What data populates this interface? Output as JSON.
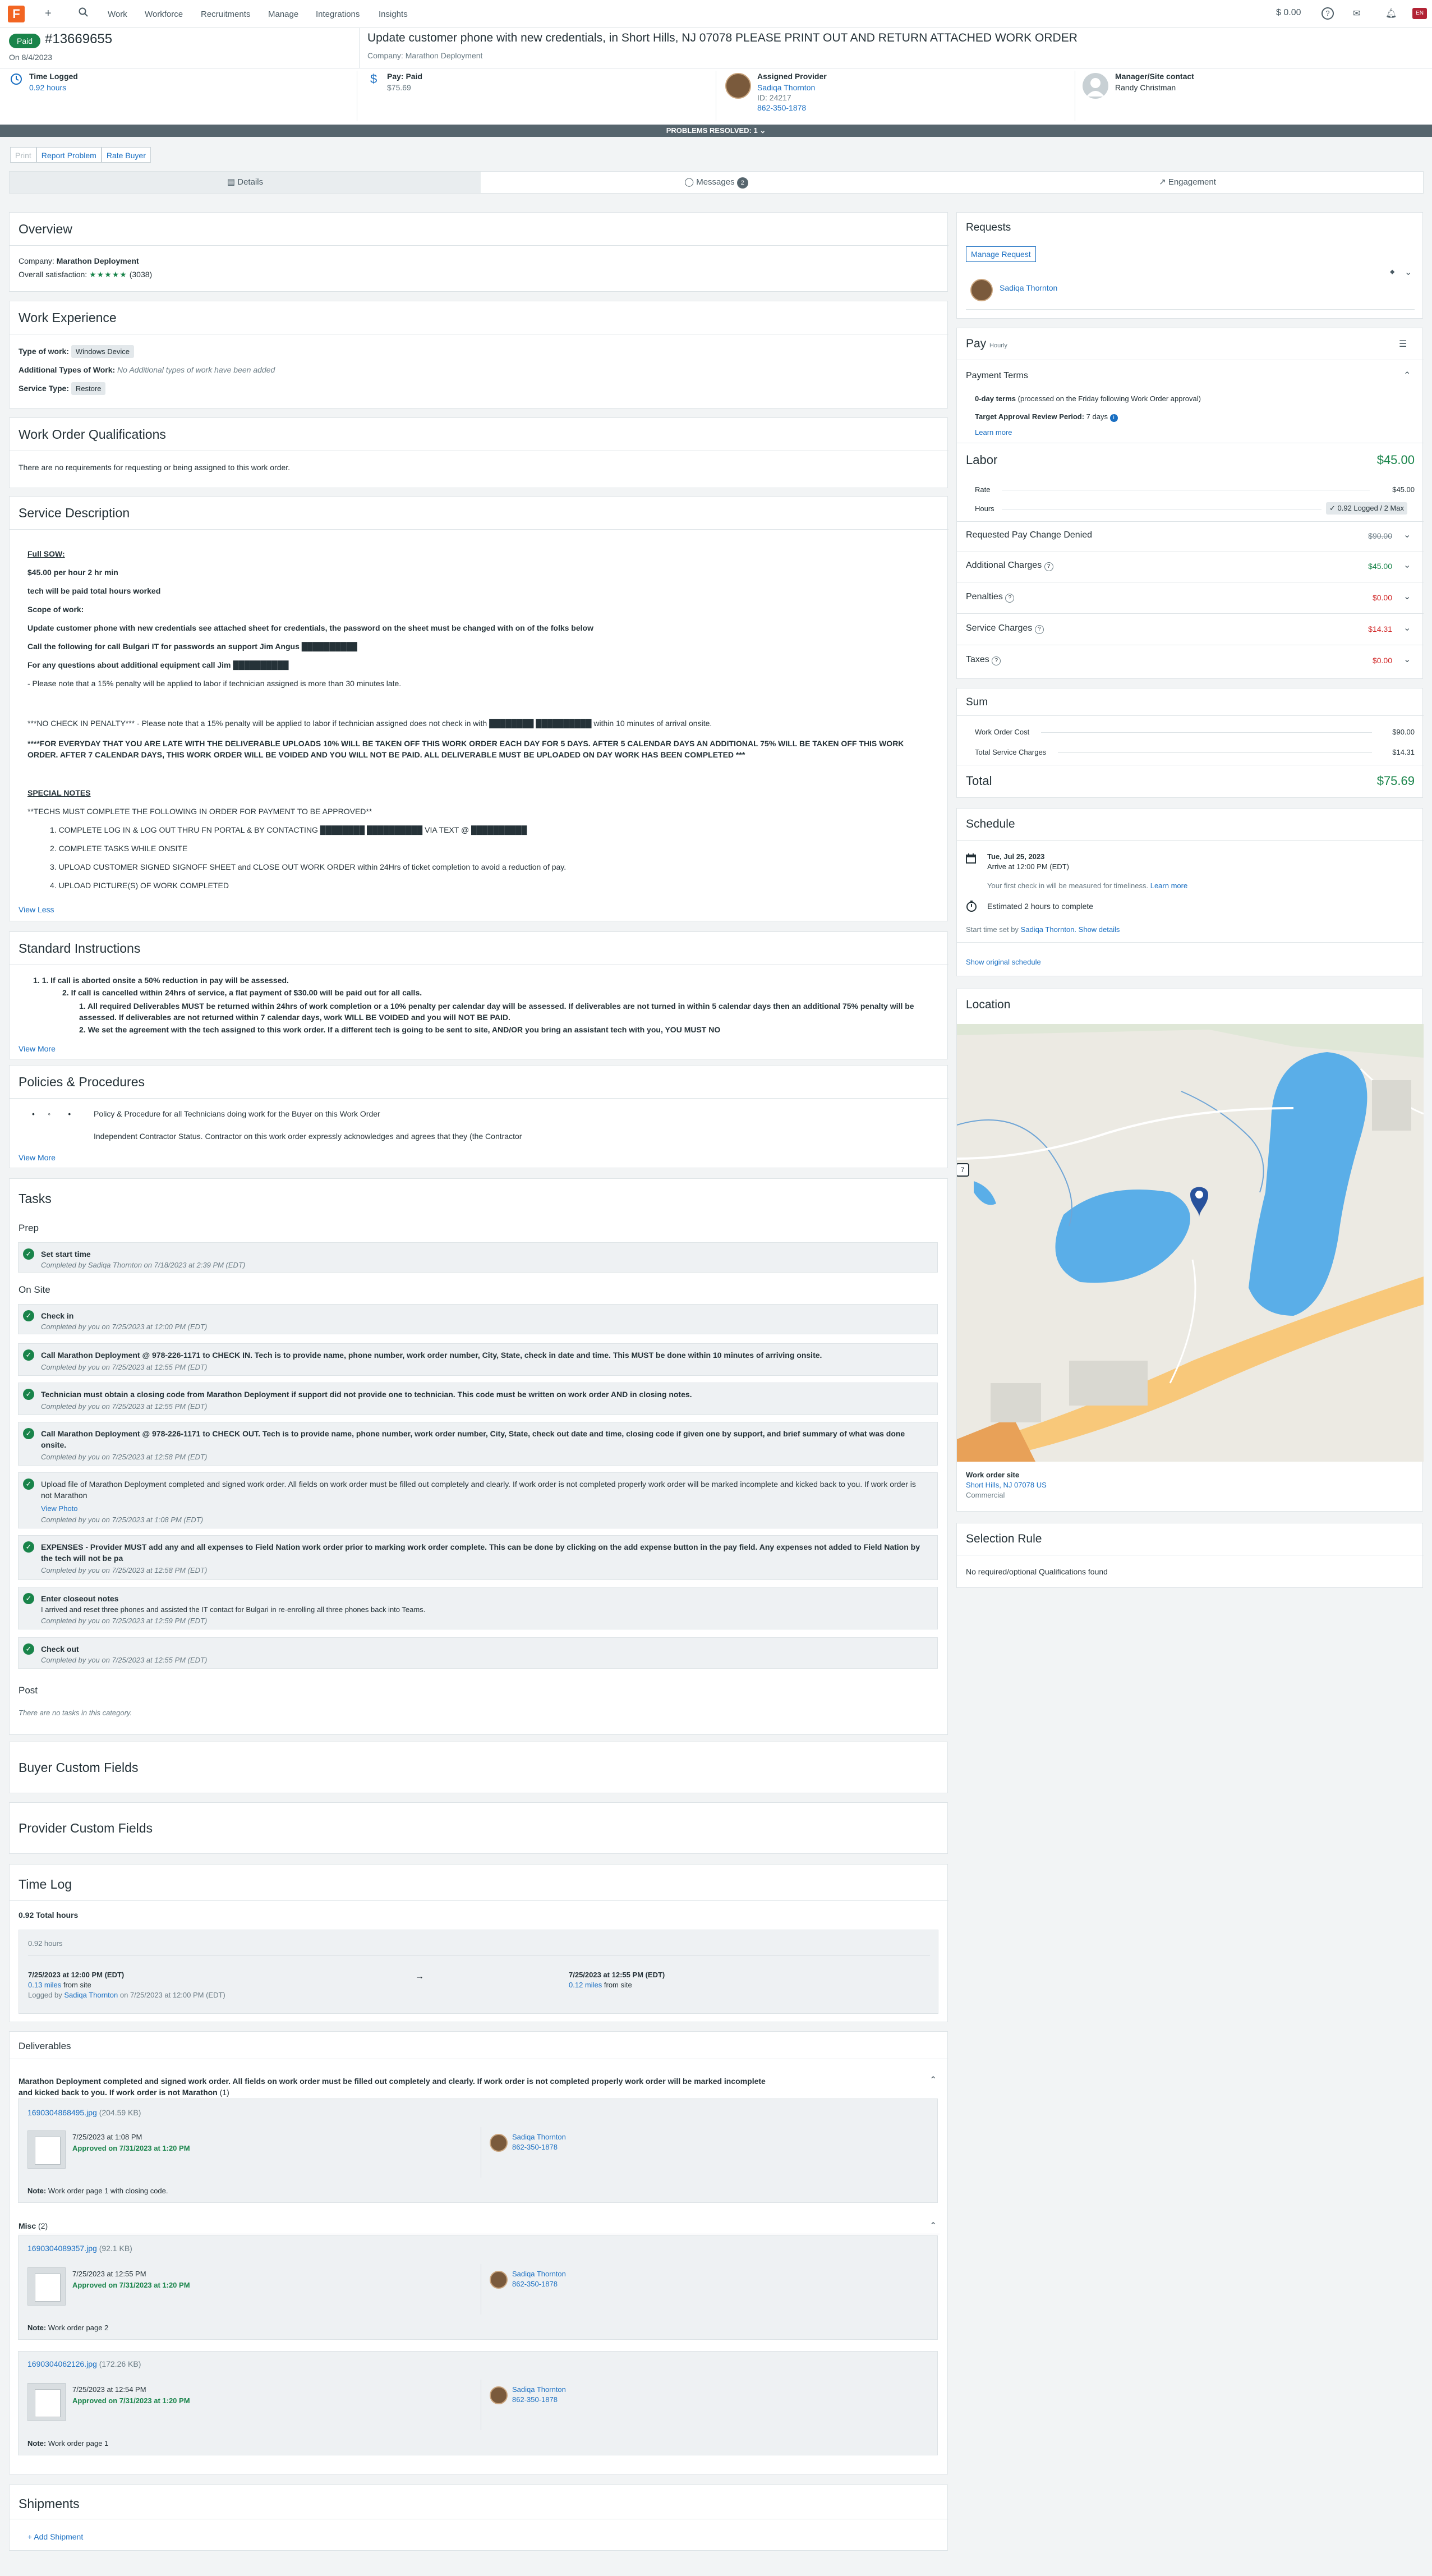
{
  "nav": {
    "logo": "F",
    "items": [
      "Work",
      "Workforce",
      "Recruitments",
      "Manage",
      "Integrations",
      "Insights"
    ],
    "balance": "0.00",
    "help": "?",
    "flag": "EN"
  },
  "header": {
    "status_badge": "Paid",
    "wo_number": "#13669655",
    "on_date": "On 8/4/2023",
    "title": "Update customer phone with new credentials, in Short Hills, NJ 07078 PLEASE PRINT OUT AND RETURN ATTACHED WORK ORDER",
    "company": "Company: Marathon Deployment"
  },
  "summary": {
    "time_logged_label": "Time Logged",
    "time_logged_value": "0.92 hours",
    "pay_label": "Pay: Paid",
    "pay_value": "$75.69",
    "provider_label": "Assigned Provider",
    "provider_name": "Sadiqa Thornton",
    "provider_id": "ID: 24217",
    "provider_phone": "862-350-1878",
    "manager_label": "Manager/Site contact",
    "manager_name": "Randy Christman"
  },
  "problems_banner": "PROBLEMS RESOLVED: 1 ⌄",
  "actions": {
    "print": "Print",
    "report": "Report Problem",
    "rate": "Rate Buyer"
  },
  "tabs": {
    "details": "Details",
    "messages": "Messages",
    "messages_count": "2",
    "engagement": "Engagement"
  },
  "overview": {
    "title": "Overview",
    "company_label": "Company:",
    "company": "Marathon Deployment",
    "satisfaction_label": "Overall satisfaction:",
    "stars": "★★★★★",
    "reviews": "(3038)"
  },
  "work_experience": {
    "title": "Work Experience",
    "type_label": "Type of work:",
    "type_value": "Windows Device",
    "additional_label": "Additional Types of Work:",
    "additional_value": "No Additional types of work have been added",
    "service_label": "Service Type:",
    "service_value": "Restore"
  },
  "qualifications": {
    "title": "Work Order Qualifications",
    "text": "There are no requirements for requesting or being assigned to this work order."
  },
  "service_description": {
    "title": "Service Description",
    "lines": [
      "Full SOW:",
      "$45.00 per hour 2 hr min",
      "tech will be paid total hours worked",
      "Scope of work:",
      "Update customer phone with new credentials see attached sheet for credentials, the password on the sheet must be changed with on of the folks below",
      "Call the following for call Bulgari IT for passwords an support Jim Angus ██████████",
      "For any questions about additional equipment call Jim ██████████",
      "- Please note that a 15% penalty will be applied to labor if technician assigned is more than 30 minutes late.",
      "***NO CHECK IN PENALTY*** - Please note that a 15% penalty will be applied to labor if technician assigned does not check in with ████████ ██████████ within 10 minutes of arrival onsite.",
      "****FOR EVERYDAY THAT YOU ARE LATE WITH THE DELIVERABLE UPLOADS 10% WILL BE TAKEN OFF THIS WORK ORDER EACH DAY FOR 5 DAYS. AFTER 5 CALENDAR DAYS AN ADDITIONAL 75% WILL BE TAKEN OFF THIS WORK ORDER. AFTER 7 CALENDAR DAYS, THIS WORK ORDER WILL BE VOIDED AND YOU WILL NOT BE PAID. ALL DELIVERABLE MUST BE UPLOADED ON DAY WORK HAS BEEN COMPLETED ***",
      "SPECIAL NOTES",
      "**TECHS MUST COMPLETE THE FOLLOWING IN ORDER FOR PAYMENT TO BE APPROVED**",
      "1. COMPLETE LOG IN & LOG OUT THRU FN PORTAL & BY CONTACTING ████████ ██████████ VIA TEXT @ ██████████",
      "2. COMPLETE TASKS WHILE ONSITE",
      "3. UPLOAD CUSTOMER SIGNED SIGNOFF SHEET and CLOSE OUT WORK ORDER within 24Hrs of ticket completion to avoid a reduction of pay.",
      "4. UPLOAD PICTURE(S) OF WORK COMPLETED"
    ],
    "view_less": "View Less"
  },
  "standard_instructions": {
    "title": "Standard Instructions",
    "items": [
      "1.  1.   If call is aborted onsite a 50% reduction in pay will be assessed.",
      "2.   If call is cancelled within 24hrs of service, a flat payment of $30.00 will be paid out for all calls.",
      "1. All required Deliverables MUST be returned within 24hrs of work completion or a 10% penalty per calendar day will be assessed.  If deliverables are not turned in within 5 calendar days then an additional 75% penalty will be assessed.  If deliverables are not returned within 7 calendar days, work WILL BE VOIDED and you will NOT BE PAID.",
      "2. We set the agreement with the tech assigned to this work order.  If a different tech is going to be sent to site, AND/OR you bring an assistant tech with you, YOU MUST NO"
    ],
    "view_more": "View More"
  },
  "policies": {
    "title": "Policies & Procedures",
    "item": "Policy & Procedure for all Technicians doing work for the Buyer on this Work Order",
    "text": "Independent Contractor Status.  Contractor on this work order expressly acknowledges and agrees that they (the Contractor",
    "view_more": "View More"
  },
  "tasks": {
    "title": "Tasks",
    "prep_label": "Prep",
    "onsite_label": "On Site",
    "post_label": "Post",
    "post_empty": "There are no tasks in this category.",
    "prep": [
      {
        "title": "Set start time",
        "completed": "Completed by Sadiqa Thornton on 7/18/2023 at 2:39 PM (EDT)"
      }
    ],
    "onsite": [
      {
        "title": "Check in",
        "completed": "Completed by you on 7/25/2023 at 12:00 PM (EDT)"
      },
      {
        "title": "Call Marathon Deployment @ 978-226-1171 to CHECK IN. Tech is to provide name, phone number, work order number, City, State, check in date and time. This MUST be done within 10 minutes of arriving onsite.",
        "completed": "Completed by you on 7/25/2023 at 12:55 PM (EDT)"
      },
      {
        "title": "Technician must obtain a closing code from Marathon Deployment if support did not provide one to technician. This code must be written on work order AND in closing notes.",
        "completed": "Completed by you on 7/25/2023 at 12:55 PM (EDT)"
      },
      {
        "title": "Call Marathon Deployment @ 978-226-1171 to CHECK OUT. Tech is to provide name, phone number, work order number, City, State, check out date and time, closing code if given one by support, and brief summary of what was done onsite.",
        "completed": "Completed by you on 7/25/2023 at 12:58 PM (EDT)"
      },
      {
        "title": "Upload file of Marathon Deployment completed and signed work order. All fields on work order must be filled out completely and clearly. If work order is not completed properly work order will be marked incomplete and kicked back to you. If work order is not Marathon",
        "extra": "View Photo",
        "completed": "Completed by you on 7/25/2023 at 1:08 PM (EDT)"
      },
      {
        "title": "EXPENSES - Provider MUST add any and all expenses to Field Nation work order prior to marking work order complete. This can be done by clicking on the add expense button in the pay field. Any expenses not added to Field Nation by the tech will not be pa",
        "completed": "Completed by you on 7/25/2023 at 12:58 PM (EDT)"
      },
      {
        "title": "Enter closeout notes",
        "note": "I arrived and reset three phones and assisted the IT contact for Bulgari in re-enrolling all three phones back into Teams.",
        "completed": "Completed by you on 7/25/2023 at 12:59 PM (EDT)"
      },
      {
        "title": "Check out",
        "completed": "Completed by you on 7/25/2023 at 12:55 PM (EDT)"
      }
    ]
  },
  "buyer_custom_fields": {
    "title": "Buyer Custom Fields"
  },
  "provider_custom_fields": {
    "title": "Provider Custom Fields"
  },
  "time_log": {
    "title": "Time Log",
    "total": "0.92 Total hours",
    "entry_hours": "0.92 hours",
    "start": "7/25/2023 at 12:00 PM (EDT)",
    "start_distance": "0.13 miles",
    "start_distance_suffix": "from site",
    "logged_by": "Logged by",
    "logged_name": "Sadiqa Thornton",
    "logged_when": "on 7/25/2023 at 12:00 PM (EDT)",
    "arrow": "→",
    "end": "7/25/2023 at 12:55 PM (EDT)",
    "end_distance": "0.12 miles",
    "end_distance_suffix": "from site"
  },
  "deliverables": {
    "title": "Deliverables",
    "group1_title": "Marathon Deployment completed and signed work order. All fields on work order must be filled out completely and clearly. If work order is not completed properly work order will be marked incomplete and kicked back to you. If work order is not Marathon",
    "group1_count": "(1)",
    "group2_title": "Misc",
    "group2_count": "(2)",
    "note_label": "Note:",
    "files": [
      {
        "name": "1690304868495.jpg",
        "size": "(204.59 KB)",
        "date": "7/25/2023 at 1:08 PM",
        "approved": "Approved on 7/31/2023 at 1:20 PM",
        "person": "Sadiqa Thornton",
        "phone": "862-350-1878",
        "note": "Work order page 1 with closing code."
      },
      {
        "name": "1690304089357.jpg",
        "size": "(92.1 KB)",
        "date": "7/25/2023 at 12:55 PM",
        "approved": "Approved on 7/31/2023 at 1:20 PM",
        "person": "Sadiqa Thornton",
        "phone": "862-350-1878",
        "note": "Work order page 2"
      },
      {
        "name": "1690304062126.jpg",
        "size": "(172.26 KB)",
        "date": "7/25/2023 at 12:54 PM",
        "approved": "Approved on 7/31/2023 at 1:20 PM",
        "person": "Sadiqa Thornton",
        "phone": "862-350-1878",
        "note": "Work order page 1"
      }
    ]
  },
  "shipments": {
    "title": "Shipments",
    "add": "+ Add Shipment"
  },
  "requests": {
    "title": "Requests",
    "manage": "Manage Request",
    "person": "Sadiqa Thornton"
  },
  "pay": {
    "title": "Pay",
    "type": "Hourly",
    "payment_terms_label": "Payment Terms",
    "terms_strong": "0-day terms",
    "terms_rest": "(processed on the Friday following Work Order approval)",
    "review_label": "Target Approval Review Period:",
    "review_value": "7 days",
    "learn_more": "Learn more",
    "labor_label": "Labor",
    "labor_value": "$45.00",
    "rate_label": "Rate",
    "rate_value": "$45.00",
    "hours_label": "Hours",
    "hours_value": "✓ 0.92 Logged / 2 Max",
    "requested_label": "Requested Pay Change Denied",
    "requested_value": "$90.00",
    "additional_label": "Additional Charges",
    "additional_value": "$45.00",
    "penalties_label": "Penalties",
    "penalties_value": "$0.00",
    "service_label": "Service Charges",
    "service_value": "$14.31",
    "taxes_label": "Taxes",
    "taxes_value": "$0.00",
    "sum_label": "Sum",
    "wo_cost_label": "Work Order Cost",
    "wo_cost_value": "$90.00",
    "total_service_label": "Total Service Charges",
    "total_service_value": "$14.31",
    "total_label": "Total",
    "total_value": "$75.69"
  },
  "schedule": {
    "title": "Schedule",
    "date": "Tue, Jul 25, 2023",
    "arrive": "Arrive at 12:00 PM (EDT)",
    "timeliness": "Your first check in will be measured for timeliness.",
    "learn_more": "Learn more",
    "estimate": "Estimated 2 hours to complete",
    "start_set_by": "Start time set by",
    "start_person": "Sadiqa Thornton.",
    "show_details": "Show details",
    "show_original": "Show original schedule"
  },
  "location": {
    "title": "Location",
    "site_label": "Work order site",
    "address": "Short Hills, NJ 07078 US",
    "type": "Commercial",
    "road_badge": "7"
  },
  "selection_rule": {
    "title": "Selection Rule",
    "text": "No required/optional Qualifications found"
  }
}
